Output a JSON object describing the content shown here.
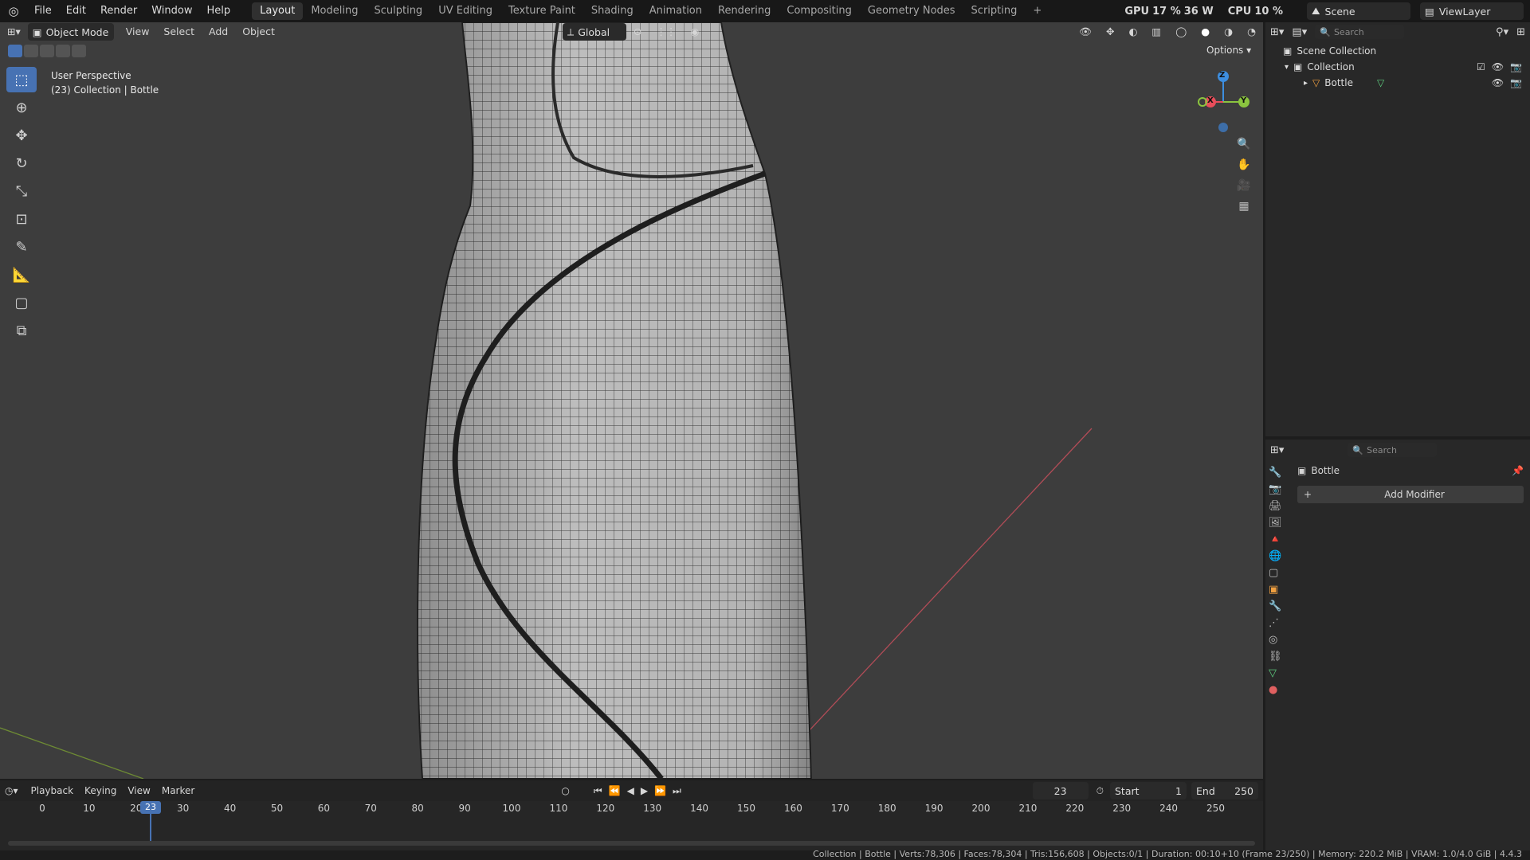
{
  "menus": [
    "File",
    "Edit",
    "Render",
    "Window",
    "Help"
  ],
  "workspace_tabs": [
    "Layout",
    "Modeling",
    "Sculpting",
    "UV Editing",
    "Texture Paint",
    "Shading",
    "Animation",
    "Rendering",
    "Compositing",
    "Geometry Nodes",
    "Scripting"
  ],
  "active_tab": "Layout",
  "plus_tab": "+",
  "perf": {
    "gpu_label": "GPU",
    "gpu_value": "17 %",
    "gpu_watts": "36 W",
    "cpu_label": "CPU",
    "cpu_value": "10 %"
  },
  "scene_name": "Scene",
  "view_layer": "ViewLayer",
  "viewport_header": {
    "mode": "Object Mode",
    "view": "View",
    "select": "Select",
    "add": "Add",
    "object": "Object",
    "orientation": "Global",
    "options": "Options"
  },
  "overlay_text": {
    "perspective": "User Perspective",
    "collection_info": "(23) Collection | Bottle"
  },
  "gizmo": {
    "x": "X",
    "y": "Y",
    "z": "Z"
  },
  "outliner": {
    "search_placeholder": "Search",
    "scene_collection": "Scene Collection",
    "collection": "Collection",
    "object": "Bottle"
  },
  "properties": {
    "search_placeholder": "Search",
    "object_name": "Bottle",
    "add_modifier": "Add Modifier",
    "add_icon": "+"
  },
  "timeline": {
    "playback": "Playback",
    "keying": "Keying",
    "view": "View",
    "marker": "Marker",
    "current_frame": "23",
    "start_label": "Start",
    "start": "1",
    "end_label": "End",
    "end": "250",
    "ticks": [
      "0",
      "10",
      "20",
      "30",
      "40",
      "50",
      "60",
      "70",
      "80",
      "90",
      "100",
      "110",
      "120",
      "130",
      "140",
      "150",
      "160",
      "170",
      "180",
      "190",
      "200",
      "210",
      "220",
      "230",
      "240",
      "250"
    ]
  },
  "status_bar": "Collection | Bottle | Verts:78,306 | Faces:78,304 | Tris:156,608 | Objects:0/1 | Duration: 00:10+10 (Frame 23/250) | Memory: 220.2 MiB | VRAM: 1.0/4.0 GiB | 4.4.3",
  "colors": {
    "accent": "#4772b3",
    "x_axis": "#e84d5a",
    "y_axis": "#8bc53f",
    "z_axis": "#3d8ee0",
    "header_bg": "#181818",
    "viewport_bg": "#3d3d3d"
  }
}
